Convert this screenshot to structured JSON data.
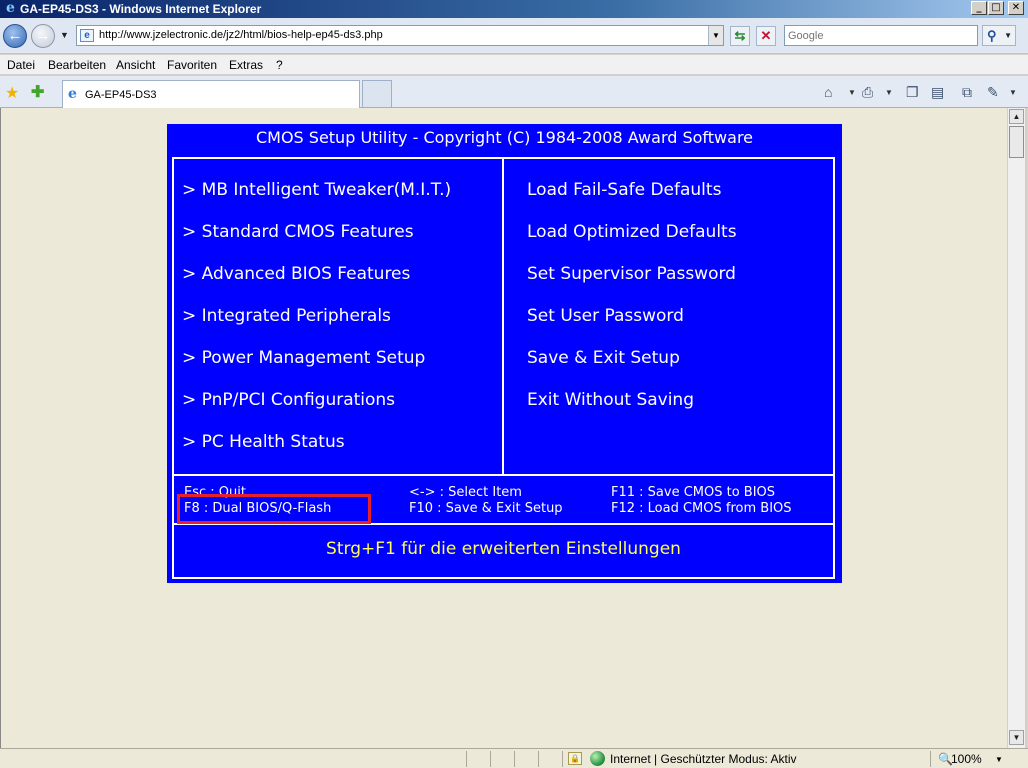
{
  "window": {
    "title": "GA-EP45-DS3 - Windows Internet Explorer",
    "buttons": {
      "minimize": "_",
      "maximize": "□",
      "close": "✕"
    }
  },
  "icons": {
    "app": "ie-icon",
    "back": "back-arrow-icon",
    "forward": "forward-arrow-icon",
    "refresh": "refresh-icon",
    "stop": "stop-icon",
    "search": "search-icon",
    "favorites": "favorites-star-icon",
    "add_favorite": "add-favorite-icon",
    "home": "home-icon",
    "print": "print-icon",
    "page": "page-icon",
    "tools": "tools-icon",
    "security": "lock-icon",
    "zone": "internet-globe-icon",
    "zoom": "zoom-icon"
  },
  "address": {
    "url": "http://www.jzelectronic.de/jz2/html/bios-help-ep45-ds3.php"
  },
  "search": {
    "placeholder": "Google"
  },
  "menu": [
    {
      "label": "Datei"
    },
    {
      "label": "Bearbeiten"
    },
    {
      "label": "Ansicht"
    },
    {
      "label": "Favoriten"
    },
    {
      "label": "Extras"
    },
    {
      "label": "?"
    }
  ],
  "tab": {
    "label": "GA-EP45-DS3"
  },
  "bios": {
    "title": "CMOS Setup Utility - Copyright (C) 1984-2008 Award Software",
    "left_items": [
      "> MB Intelligent Tweaker(M.I.T.)",
      "> Standard CMOS Features",
      "> Advanced BIOS Features",
      "> Integrated Peripherals",
      "> Power Management Setup",
      "> PnP/PCI Configurations",
      "> PC Health Status"
    ],
    "right_items": [
      "Load Fail-Safe Defaults",
      "Load Optimized Defaults",
      "Set Supervisor Password",
      "Set User Password",
      "Save & Exit Setup",
      "Exit Without Saving"
    ],
    "keys": {
      "esc": "Esc : Quit",
      "f8": "F8   : Dual BIOS/Q-Flash",
      "arrows": "<-> : Select Item",
      "f10": "F10 : Save & Exit Setup",
      "f11": "F11 : Save CMOS to BIOS",
      "f12": "F12 : Load CMOS from BIOS"
    },
    "hint": "Strg+F1 für die erweiterten Einstellungen",
    "colors": {
      "background": "#0000ff",
      "text": "#ffffff",
      "hint": "#ffff55",
      "highlight_box": "#e8202e"
    }
  },
  "status": {
    "zone_text": "Internet | Geschützter Modus: Aktiv",
    "zoom": "100%"
  }
}
